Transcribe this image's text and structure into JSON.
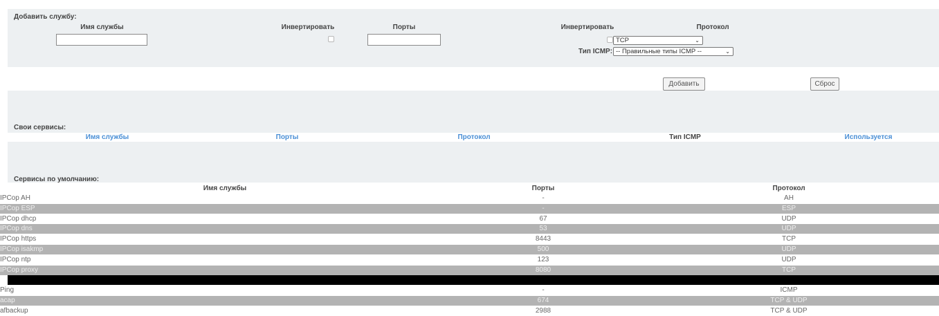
{
  "add_service": {
    "section_title": "Добавить службу:",
    "col_name": "Имя службы",
    "col_invert1": "Инвертировать",
    "col_ports": "Порты",
    "col_invert2": "Инвертировать",
    "col_protocol": "Протокол",
    "name_value": "",
    "ports_value": "",
    "protocol_selected": "TCP",
    "icmp_label": "Тип ICMP:",
    "icmp_selected": "-- Правильные типы ICMP --",
    "add_button": "Добавить",
    "reset_button": "Сброс"
  },
  "custom_services": {
    "section_title": "Свои сервисы:",
    "col_name": "Имя службы",
    "col_ports": "Порты",
    "col_protocol": "Протокол",
    "col_icmp": "Тип ICMP",
    "col_used": "Используется"
  },
  "default_services": {
    "section_title": "Сервисы по умолчанию:",
    "col_name": "Имя службы",
    "col_ports": "Порты",
    "col_protocol": "Протокол",
    "rows": [
      {
        "name": "IPCop AH",
        "ports": "-",
        "protocol": "AH"
      },
      {
        "name": "IPCop ESP",
        "ports": "-",
        "protocol": "ESP"
      },
      {
        "name": "IPCop dhcp",
        "ports": "67",
        "protocol": "UDP"
      },
      {
        "name": "IPCop dns",
        "ports": "53",
        "protocol": "UDP"
      },
      {
        "name": "IPCop https",
        "ports": "8443",
        "protocol": "TCP"
      },
      {
        "name": "IPCop isakmp",
        "ports": "500",
        "protocol": "UDP"
      },
      {
        "name": "IPCop ntp",
        "ports": "123",
        "protocol": "UDP"
      },
      {
        "name": "IPCop proxy",
        "ports": "8080",
        "protocol": "TCP"
      },
      {
        "name": "Ping",
        "ports": "-",
        "protocol": "ICMP"
      },
      {
        "name": "acap",
        "ports": "674",
        "protocol": "TCP & UDP"
      },
      {
        "name": "afbackup",
        "ports": "2988",
        "protocol": "TCP & UDP"
      }
    ]
  },
  "colors": {
    "section_bg": "#edf0f2",
    "row_alt": "#b3b3b3",
    "header_blue": "#4a8fd6",
    "black_bar": "#000000"
  }
}
